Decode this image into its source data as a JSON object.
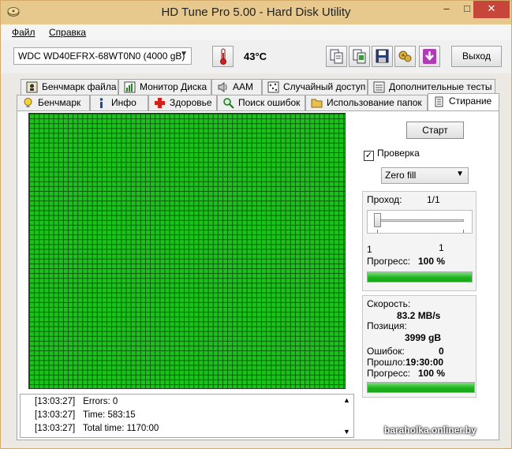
{
  "window": {
    "title": "HD Tune Pro 5.00 - Hard Disk Utility",
    "min": "–",
    "max": "□",
    "close": "✕"
  },
  "menu": {
    "file": "Файл",
    "help": "Справка"
  },
  "toolbar": {
    "drive": "WDC WD40EFRX-68WT0N0 (4000 gB)",
    "temperature": "43°C",
    "exit_label": "Выход",
    "icons": [
      "thermometer-icon",
      "copy-info-icon",
      "copy-screenshot-icon",
      "save-icon",
      "options-icon",
      "download-icon"
    ]
  },
  "tabs_top": [
    {
      "label": "Бенчмарк файла",
      "icon": "file-benchmark-icon"
    },
    {
      "label": "Монитор Диска",
      "icon": "disk-monitor-icon"
    },
    {
      "label": "AAM",
      "icon": "speaker-icon"
    },
    {
      "label": "Случайный доступ",
      "icon": "random-access-icon"
    },
    {
      "label": "Дополнительные  тесты",
      "icon": "extra-tests-icon"
    }
  ],
  "tabs_bottom": [
    {
      "label": "Бенчмарк",
      "icon": "benchmark-icon"
    },
    {
      "label": "Инфо",
      "icon": "info-icon"
    },
    {
      "label": "Здоровье",
      "icon": "health-cross-icon"
    },
    {
      "label": "Поиск ошибок",
      "icon": "magnifier-icon"
    },
    {
      "label": "Использование папок",
      "icon": "folder-icon"
    },
    {
      "label": "Стирание",
      "icon": "erase-icon",
      "active": true
    }
  ],
  "log": [
    {
      "time": "[13:03:27]",
      "text": "Errors: 0"
    },
    {
      "time": "[13:03:27]",
      "text": "Time: 583:15"
    },
    {
      "time": "[13:03:27]",
      "text": "Total time: 1170:00"
    }
  ],
  "controls": {
    "start_label": "Старт",
    "verify_label": "Проверка",
    "verify_checked": true,
    "check_mark": "✓",
    "method": "Zero fill"
  },
  "pass": {
    "label": "Проход:",
    "value": "1/1",
    "slider_min": "1",
    "slider_max": "1",
    "progress_label": "Прогресс:",
    "progress_value": "100 %",
    "progress_fraction": 1.0
  },
  "stats": {
    "speed_label": "Скорость:",
    "speed_value": "83.2 MB/s",
    "position_label": "Позиция:",
    "position_value": "3999 gB",
    "errors_label": "Ошибок:",
    "errors_value": "0",
    "elapsed_label": "Прошло:",
    "elapsed_value": "19:30:00",
    "progress_label": "Прогресс:",
    "progress_value": "100 %",
    "progress_fraction": 1.0
  },
  "watermark": "baraholka.onliner.by",
  "colors": {
    "grid_block": "#1bc21b",
    "grid_line": "#0a5a0a",
    "progress": "#1fb31f"
  }
}
